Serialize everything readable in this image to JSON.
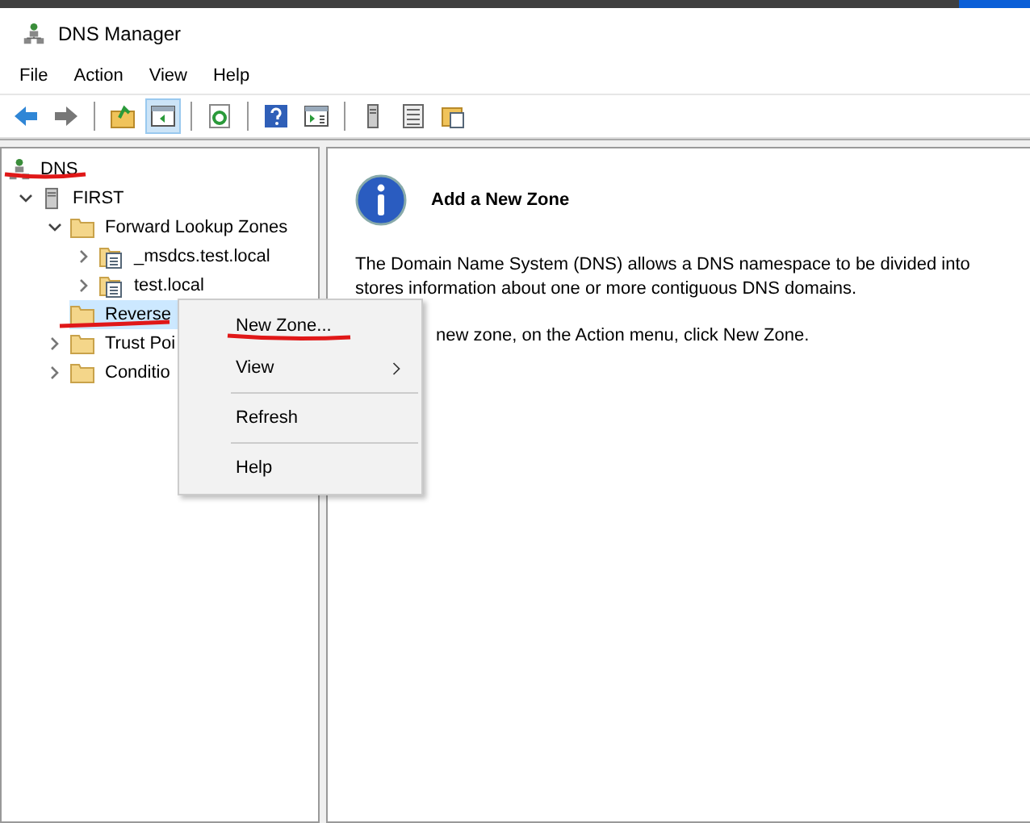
{
  "window": {
    "title": "DNS Manager"
  },
  "menu_bar": [
    "File",
    "Action",
    "View",
    "Help"
  ],
  "toolbar": [
    {
      "kind": "back",
      "pressed": false
    },
    {
      "kind": "forward",
      "pressed": false
    },
    {
      "kind": "up",
      "pressed": false
    },
    {
      "kind": "tree",
      "pressed": true
    },
    {
      "kind": "refresh",
      "pressed": false
    },
    {
      "kind": "help",
      "pressed": false
    },
    {
      "kind": "pane",
      "pressed": false
    },
    {
      "kind": "server",
      "pressed": false
    },
    {
      "kind": "list",
      "pressed": false
    },
    {
      "kind": "zone",
      "pressed": false
    }
  ],
  "tree": [
    {
      "label": "DNS",
      "kind": "dns",
      "selected": false,
      "children": [
        {
          "label": "FIRST",
          "kind": "server",
          "expanded": true,
          "selected": false,
          "children": [
            {
              "label": "Forward Lookup Zones",
              "kind": "folder",
              "expanded": true,
              "selected": false,
              "children": [
                {
                  "label": "_msdcs.test.local",
                  "kind": "zone",
                  "expanded": false,
                  "selected": false
                },
                {
                  "label": "test.local",
                  "kind": "zone",
                  "expanded": false,
                  "selected": false
                }
              ]
            },
            {
              "label": "Reverse",
              "kind": "folder",
              "selected": true
            },
            {
              "label": "Trust Poi",
              "kind": "folder",
              "expanded": false,
              "selected": false
            },
            {
              "label": "Conditio",
              "kind": "folder",
              "expanded": false,
              "selected": false
            }
          ]
        }
      ]
    }
  ],
  "details": {
    "heading": "Add a New Zone",
    "paragraph": "The Domain Name System (DNS) allows a DNS namespace to be divided into",
    "paragraph_2": "stores information about one or more contiguous DNS domains.",
    "instruction": "new zone, on the Action menu, click New Zone."
  },
  "context_menu": [
    {
      "label": "New Zone...",
      "kind": "item",
      "submenu": false
    },
    {
      "label": "View",
      "kind": "item",
      "submenu": true
    },
    {
      "kind": "separator"
    },
    {
      "label": "Refresh",
      "kind": "item",
      "submenu": false
    },
    {
      "kind": "separator"
    },
    {
      "label": "Help",
      "kind": "item",
      "submenu": false
    }
  ]
}
